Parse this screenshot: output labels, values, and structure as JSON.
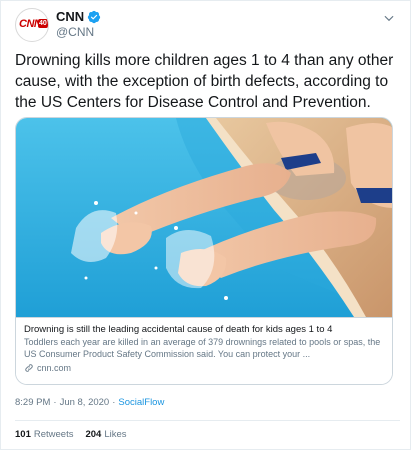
{
  "author": {
    "display_name": "CNN",
    "handle": "@CNN",
    "avatar_logo": "CNN",
    "avatar_badge": "40",
    "verified_icon": "verified-badge-icon"
  },
  "tweet": {
    "text": "Drowning kills more children ages 1 to 4 than any other cause, with the exception of birth defects, according to the US Centers for Disease Control and Prevention."
  },
  "card": {
    "image_alt": "Children's feet splashing in a swimming pool",
    "title": "Drowning is still the leading accidental cause of death for kids ages 1 to 4",
    "description": "Toddlers each year are killed in an average of 379 drownings related to pools or spas, the US Consumer Product Safety Commission said. You can protect your ...",
    "domain": "cnn.com"
  },
  "meta": {
    "time": "8:29 PM",
    "separator": "·",
    "date": "Jun 8, 2020",
    "separator2": "·",
    "source": "SocialFlow"
  },
  "stats": {
    "retweets_count": "101",
    "retweets_label": "Retweets",
    "likes_count": "204",
    "likes_label": "Likes"
  },
  "colors": {
    "accent": "#1b95e0",
    "cnn_red": "#cc0000",
    "pool_water": "#3fb5e0"
  }
}
